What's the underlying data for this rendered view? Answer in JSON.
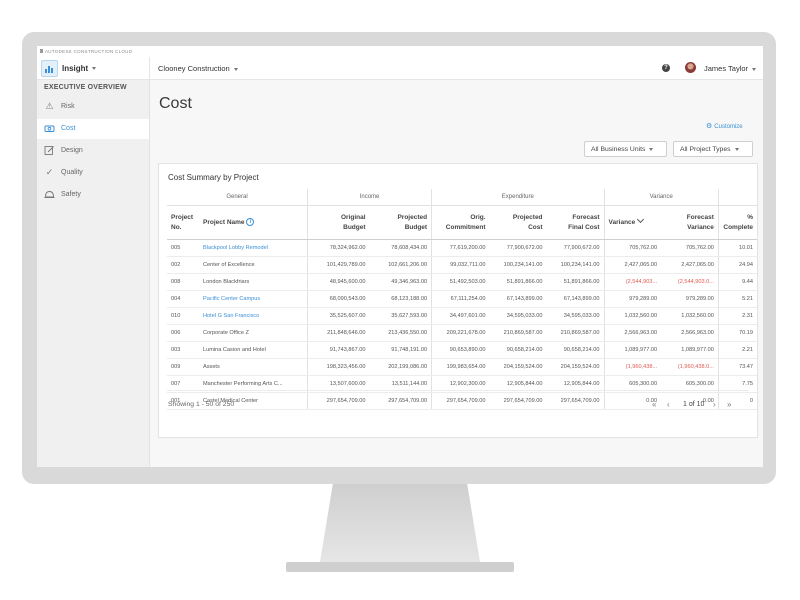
{
  "topbar": {
    "brand": "AUTODESK CONSTRUCTION CLOUD"
  },
  "header": {
    "app_name": "Insight",
    "project": "Clooney Construction",
    "help": "?",
    "user_name": "James Taylor"
  },
  "sidebar": {
    "section_title": "EXECUTIVE OVERVIEW",
    "items": [
      {
        "label": "Risk",
        "icon": "warning-icon",
        "active": false
      },
      {
        "label": "Cost",
        "icon": "money-icon",
        "active": true
      },
      {
        "label": "Design",
        "icon": "pencil-icon",
        "active": false
      },
      {
        "label": "Quality",
        "icon": "checkmark-icon",
        "active": false
      },
      {
        "label": "Safety",
        "icon": "hardhat-icon",
        "active": false
      }
    ]
  },
  "main": {
    "title": "Cost",
    "customize_label": "Customize",
    "filters": {
      "business_units": "All Business Units",
      "project_types": "All Project Types"
    }
  },
  "card": {
    "title": "Cost Summary by Project",
    "groups": {
      "general": "General",
      "income": "Income",
      "expenditure": "Expenditure",
      "variance": "Variance"
    },
    "columns": {
      "project_no": "Project No.",
      "project_name": "Project Name",
      "original_budget": "Original Budget",
      "projected_budget": "Projected Budget",
      "orig_commitment": "Orig. Commitment",
      "projected_cost": "Projected Cost",
      "forecast_final_cost": "Forecast Final Cost",
      "variance": "Variance",
      "forecast_variance": "Forecast Variance",
      "pct_complete": "% Complete"
    },
    "rows": [
      {
        "no": "005",
        "name": "Blackpool Lobby Remodel",
        "link": true,
        "ob": "78,324,962.00",
        "pb": "78,608,434.00",
        "oc": "77,619,200.00",
        "pc": "77,900,672.00",
        "ffc": "77,900,672.00",
        "var": "705,762.00",
        "fvar": "705,762.00",
        "neg": false,
        "pct": "10.01"
      },
      {
        "no": "002",
        "name": "Center of Excellence",
        "link": false,
        "ob": "101,429,789.00",
        "pb": "102,661,206.00",
        "oc": "99,032,711.00",
        "pc": "100,234,141.00",
        "ffc": "100,234,141.00",
        "var": "2,427,065.00",
        "fvar": "2,427,065.00",
        "neg": false,
        "pct": "24.94"
      },
      {
        "no": "008",
        "name": "London Blackfriars",
        "link": false,
        "ob": "48,945,600.00",
        "pb": "49,346,963.00",
        "oc": "51,492,503.00",
        "pc": "51,891,866.00",
        "ffc": "51,891,866.00",
        "var": "(2,544,903...",
        "fvar": "(2,544,903.0...",
        "neg": true,
        "pct": "9.44"
      },
      {
        "no": "004",
        "name": "Pacific Center Campus",
        "link": true,
        "ob": "68,090,543.00",
        "pb": "68,123,188.00",
        "oc": "67,111,254.00",
        "pc": "67,143,899.00",
        "ffc": "67,143,899.00",
        "var": "979,289.00",
        "fvar": "979,289.00",
        "neg": false,
        "pct": "5.21"
      },
      {
        "no": "010",
        "name": "Hotel G San Francisco",
        "link": true,
        "ob": "35,525,607.00",
        "pb": "35,627,593.00",
        "oc": "34,497,601.00",
        "pc": "34,595,033.00",
        "ffc": "34,595,033.00",
        "var": "1,032,560.00",
        "fvar": "1,032,560.00",
        "neg": false,
        "pct": "2.31"
      },
      {
        "no": "006",
        "name": "Corporate Office Z",
        "link": false,
        "ob": "211,848,646.00",
        "pb": "213,436,550.00",
        "oc": "209,221,678.00",
        "pc": "210,869,587.00",
        "ffc": "210,869,587.00",
        "var": "2,566,963.00",
        "fvar": "2,566,963.00",
        "neg": false,
        "pct": "70.19"
      },
      {
        "no": "003",
        "name": "Lumina Casion and Hotel",
        "link": false,
        "ob": "91,743,867.00",
        "pb": "91,748,191.00",
        "oc": "90,653,890.00",
        "pc": "90,658,214.00",
        "ffc": "90,658,214.00",
        "var": "1,089,977.00",
        "fvar": "1,089,977.00",
        "neg": false,
        "pct": "2.21"
      },
      {
        "no": "009",
        "name": "Assets",
        "link": false,
        "ob": "198,323,456.00",
        "pb": "202,199,086.00",
        "oc": "199,983,654.00",
        "pc": "204,159,524.00",
        "ffc": "204,159,524.00",
        "var": "(1,960,438...",
        "fvar": "(1,960,438.0...",
        "neg": true,
        "pct": "73.47"
      },
      {
        "no": "007",
        "name": "Manchester Performing Arts C...",
        "link": false,
        "ob": "13,507,600.00",
        "pb": "13,511,144.00",
        "oc": "12,902,300.00",
        "pc": "12,905,844.00",
        "ffc": "12,905,844.00",
        "var": "605,300.00",
        "fvar": "605,300.00",
        "neg": false,
        "pct": "7.75"
      },
      {
        "no": "001",
        "name": "Castel Medical Center",
        "link": false,
        "ob": "297,654,709.00",
        "pb": "297,654,709.00",
        "oc": "297,654,709.00",
        "pc": "297,654,709.00",
        "ffc": "297,654,709.00",
        "var": "0.00",
        "fvar": "0.00",
        "neg": false,
        "pct": "0"
      }
    ],
    "showing": "Showing 1 - 50 of 250",
    "page_info": "1 of 10"
  },
  "colors": {
    "accent": "#3a8fd6",
    "negative": "#e05a4f"
  }
}
